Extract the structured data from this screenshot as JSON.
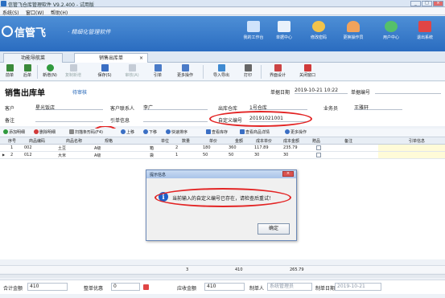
{
  "window": {
    "title": "信管飞仓库管理软件 V9.2.400 - 试用版"
  },
  "menu": [
    "系统(S)",
    "窗口(W)",
    "帮助(H)"
  ],
  "banner": {
    "logo": "信管飞",
    "subtitle": "· 精细化管理软件",
    "items": [
      {
        "label": "我的工作台",
        "color": "#3c7fd4"
      },
      {
        "label": "单据中心",
        "color": "#5b9be0"
      },
      {
        "label": "修改密码",
        "color": "#e0a020"
      },
      {
        "label": "更换操作员",
        "color": "#e08a3c"
      },
      {
        "label": "用户中心",
        "color": "#3fa654"
      },
      {
        "label": "退出系统",
        "color": "#d23a3a"
      }
    ]
  },
  "tabs": [
    "功能导航菜",
    "销售出库单"
  ],
  "toolbar": {
    "buttons": [
      {
        "label": "前单",
        "color": "#3a8a3a"
      },
      {
        "label": "后单",
        "color": "#3a8a3a"
      },
      {
        "label": "新增(N)",
        "color": "#2f9a3e"
      },
      {
        "label": "复制新增",
        "color": "#9aa"
      },
      {
        "label": "保存(S)",
        "color": "#3b6fc4"
      },
      {
        "label": "审核(A)",
        "color": "#9aa"
      },
      {
        "label": "引单",
        "color": "#4a7bc8"
      },
      {
        "label": "更多操作",
        "color": "#4a7bc8"
      },
      {
        "label": "导入导出",
        "color": "#3f8ad1"
      },
      {
        "label": "打印",
        "color": "#555"
      },
      {
        "label": "界面设计",
        "color": "#c44"
      },
      {
        "label": "关闭窗口",
        "color": "#d13a3a"
      }
    ]
  },
  "doc": {
    "title": "销售出库单",
    "status": "待审核",
    "date_label": "单据日期",
    "date_value": "2019-10-21 10:22",
    "docno_label": "单据编号",
    "customer_label": "客户",
    "customer_value": "星光饭店",
    "contact_label": "客户联系人",
    "contact_value": "李广",
    "warehouse_label": "出库仓库",
    "warehouse_value": "1号仓库",
    "sales_label": "业务员",
    "sales_value": "王雅轩",
    "remark_label": "备注",
    "ref_label": "引单信息",
    "customno_label": "自定义编号",
    "customno_value": "20191021001"
  },
  "gridbar": [
    {
      "label": "添加明细",
      "color": "#2f9a3e"
    },
    {
      "label": "删除明细",
      "color": "#d13a3a"
    },
    {
      "label": "扫描条形码(F4)",
      "color": "#888"
    },
    {
      "label": "上移",
      "color": "#3b6fc4"
    },
    {
      "label": "下移",
      "color": "#3b6fc4"
    },
    {
      "label": "快速排序",
      "color": "#3b6fc4"
    },
    {
      "label": "查看库存",
      "color": "#3b6fc4"
    },
    {
      "label": "查看商品详情",
      "color": "#3b6fc4"
    },
    {
      "label": "更多操作",
      "color": "#3b6fc4"
    }
  ],
  "grid": {
    "columns": [
      "序号",
      "商品编码",
      "商品名称",
      "规格",
      "单位",
      "数量",
      "单价",
      "金额",
      "成本单价",
      "成本金额",
      "赠品",
      "备注",
      "引单信息"
    ],
    "rows": [
      {
        "seq": "1",
        "code": "002",
        "name": "土豆",
        "spec": "A级",
        "unit": "箱",
        "qty": "2",
        "price": "180",
        "amount": "360",
        "cost": "117.89",
        "cost_amount": "235.79"
      },
      {
        "seq": "2",
        "code": "012",
        "name": "大米",
        "spec": "A级",
        "unit": "袋",
        "qty": "1",
        "price": "50",
        "amount": "50",
        "cost": "30",
        "cost_amount": "30"
      }
    ],
    "totals": {
      "qty": "3",
      "amount": "410",
      "cost_amount": "265.79"
    }
  },
  "dialog": {
    "title": "提示信息",
    "message": "当前输入的自定义编号已存在，请检查后重试！",
    "ok": "确定"
  },
  "footer": {
    "total_label": "合计金额",
    "total_value": "410",
    "discount_label": "整单优惠",
    "discount_value": "0",
    "receivable_label": "应收金额",
    "receivable_value": "410",
    "maker_label": "制单人",
    "maker_value": "系统管理员",
    "makedate_label": "制单日期",
    "makedate_value": "2019-10-21"
  }
}
